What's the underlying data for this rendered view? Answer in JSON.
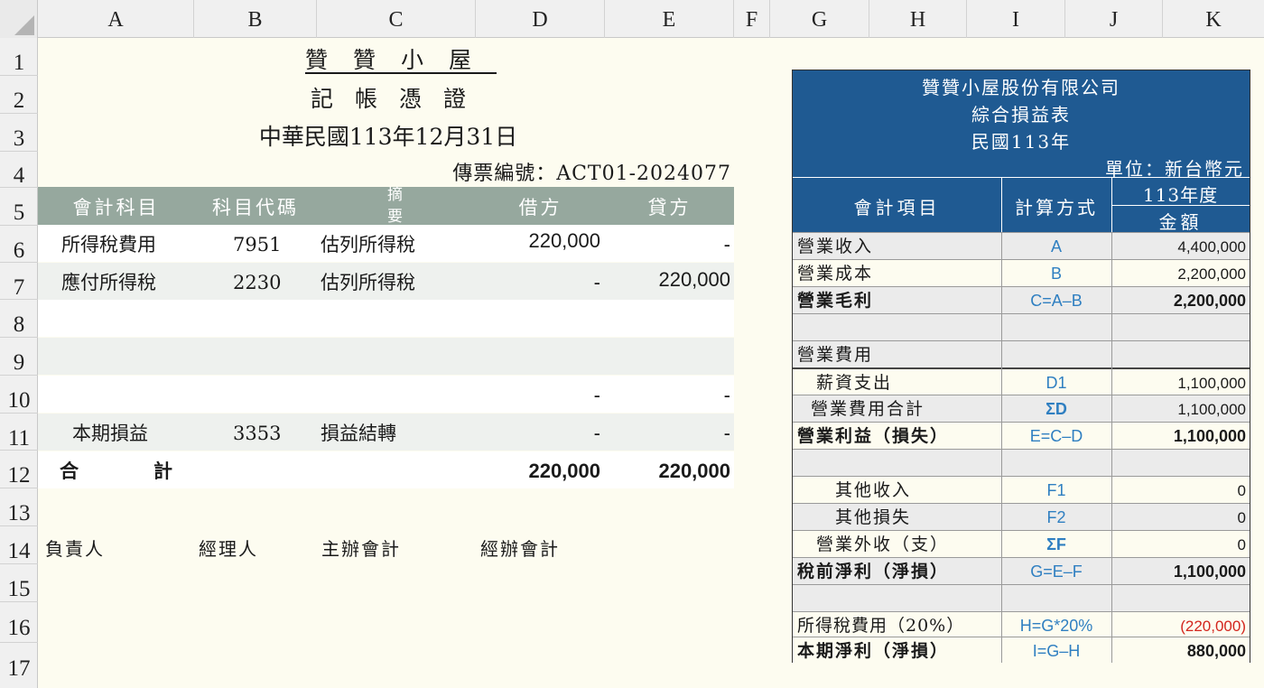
{
  "columns": [
    "A",
    "B",
    "C",
    "D",
    "E",
    "F",
    "G",
    "H",
    "I",
    "J",
    "K"
  ],
  "rows": [
    "1",
    "2",
    "3",
    "4",
    "5",
    "6",
    "7",
    "8",
    "9",
    "10",
    "11",
    "12",
    "13",
    "14",
    "15",
    "16",
    "17"
  ],
  "voucher": {
    "title": "贊贊小屋",
    "subtitle": "記帳憑證",
    "date": "中華民國113年12月31日",
    "voucher_no": "傳票編號：ACT01-2024077",
    "headers": {
      "account": "會計科目",
      "code": "科目代碼",
      "summary_top": "摘",
      "summary_bottom": "要",
      "debit": "借方",
      "credit": "貸方"
    },
    "entries": [
      {
        "account": "所得稅費用",
        "code": "7951",
        "summary": "估列所得稅",
        "debit": "220,000",
        "credit": "-"
      },
      {
        "account": "應付所得稅",
        "code": "2230",
        "summary": "估列所得稅",
        "debit": "-",
        "credit": "220,000"
      },
      {
        "account": "",
        "code": "",
        "summary": "",
        "debit": "",
        "credit": ""
      },
      {
        "account": "",
        "code": "",
        "summary": "",
        "debit": "",
        "credit": ""
      },
      {
        "account": "",
        "code": "",
        "summary": "",
        "debit": "-",
        "credit": "-"
      },
      {
        "account": "本期損益",
        "code": "3353",
        "summary": "損益結轉",
        "debit": "-",
        "credit": "-"
      }
    ],
    "total": {
      "label_left": "合",
      "label_right": "計",
      "debit": "220,000",
      "credit": "220,000"
    },
    "signatures": [
      "負責人",
      "經理人",
      "主辦會計",
      "經辦會計"
    ]
  },
  "income_statement": {
    "company": "贊贊小屋股份有限公司",
    "title": "綜合損益表",
    "period": "民國113年",
    "unit": "單位：新台幣元",
    "col_item": "會計項目",
    "col_method": "計算方式",
    "col_year": "113年度",
    "col_amount": "金額",
    "lines": [
      {
        "item": "營業收入",
        "formula": "A",
        "amount": "4,400,000",
        "style": "shade"
      },
      {
        "item": "營業成本",
        "formula": "B",
        "amount": "2,200,000",
        "style": "plain"
      },
      {
        "item": "營業毛利",
        "formula": "C=A–B",
        "amount": "2,200,000",
        "style": "shade",
        "bold": true
      },
      {
        "item": "",
        "formula": "",
        "amount": "",
        "style": "shade"
      },
      {
        "item": "營業費用",
        "formula": "",
        "amount": "",
        "style": "shade"
      },
      {
        "item": "　薪資支出",
        "formula": "D1",
        "amount": "1,100,000",
        "style": "plain"
      },
      {
        "item": " 營業費用合計",
        "formula": "ΣD",
        "amount": "1,100,000",
        "style": "shade",
        "sig": true
      },
      {
        "item": "營業利益（損失）",
        "formula": "E=C–D",
        "amount": "1,100,000",
        "style": "plain",
        "bold": true
      },
      {
        "item": "",
        "formula": "",
        "amount": "",
        "style": "shade"
      },
      {
        "item": "　　其他收入",
        "formula": "F1",
        "amount": "0",
        "style": "plain"
      },
      {
        "item": "　　其他損失",
        "formula": "F2",
        "amount": "0",
        "style": "shade"
      },
      {
        "item": "　營業外收（支）",
        "formula": "ΣF",
        "amount": "0",
        "style": "plain",
        "sig": true
      },
      {
        "item": "稅前淨利（淨損）",
        "formula": "G=E–F",
        "amount": "1,100,000",
        "style": "shade",
        "bold": true
      },
      {
        "item": "",
        "formula": "",
        "amount": "",
        "style": "shade"
      },
      {
        "item": "所得稅費用（20%）",
        "formula": "H=G*20%",
        "amount": "(220,000)",
        "style": "plain",
        "neg": true
      },
      {
        "item": "本期淨利（淨損）",
        "formula": "I=G–H",
        "amount": "880,000",
        "style": "plain",
        "bold": true
      }
    ]
  },
  "colors": {
    "voucher_header": "#96a89e",
    "statement_header": "#1f5a92",
    "formula_text": "#2f7fc1",
    "negative": "#d3261e",
    "sheet_bg": "#fdfcf0"
  }
}
